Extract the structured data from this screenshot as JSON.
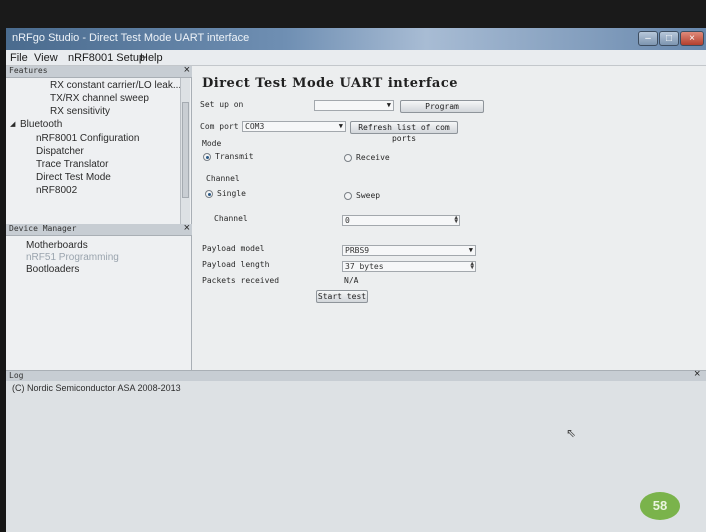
{
  "window": {
    "title": "nRFgo Studio - Direct Test Mode UART interface",
    "minimize": "–",
    "maximize": "□",
    "close": "×"
  },
  "menu": [
    "File",
    "View",
    "nRF8001 Setup",
    "Help"
  ],
  "features_pane": {
    "header": "Features",
    "items": [
      {
        "label": "RX constant carrier/LO leak...",
        "indent": 3
      },
      {
        "label": "TX/RX channel sweep",
        "indent": 3
      },
      {
        "label": "RX sensitivity",
        "indent": 3
      },
      {
        "label": "Bluetooth",
        "indent": 1
      },
      {
        "label": "nRF8001 Configuration",
        "indent": 2
      },
      {
        "label": "Dispatcher",
        "indent": 2
      },
      {
        "label": "Trace Translator",
        "indent": 2
      },
      {
        "label": "Direct Test Mode",
        "indent": 2
      },
      {
        "label": "nRF8002",
        "indent": 2
      }
    ],
    "close": "×",
    "tree_expander": "◢"
  },
  "devices_pane": {
    "header": "Device Manager",
    "items": [
      "Motherboards",
      "nRF51 Programming",
      "Bootloaders"
    ],
    "close": "×"
  },
  "main": {
    "title": "Direct Test Mode UART interface",
    "setup_label": "Set up on",
    "setup_value": "",
    "program_button": "Program",
    "com_port_label": "Com port",
    "com_port_value": "COM3",
    "refresh_button": "Refresh list of com ports",
    "mode_label": "Mode",
    "transmit_label": "Transmit",
    "receive_label": "Receive",
    "mode_selected": "transmit",
    "channel_group_label": "Channel",
    "single_label": "Single",
    "sweep_label": "Sweep",
    "channel_mode_selected": "single",
    "channel_label": "Channel",
    "channel_value": "0",
    "payload_model_label": "Payload model",
    "payload_model_value": "PRBS9",
    "payload_length_label": "Payload length",
    "payload_length_value": "37 bytes",
    "packets_received_label": "Packets received",
    "packets_received_value": "N/A",
    "start_button": "Start test"
  },
  "log": {
    "header": "Log",
    "line": "(C) Nordic Semiconductor ASA 2008-2013",
    "close": "×"
  },
  "badge": "58"
}
